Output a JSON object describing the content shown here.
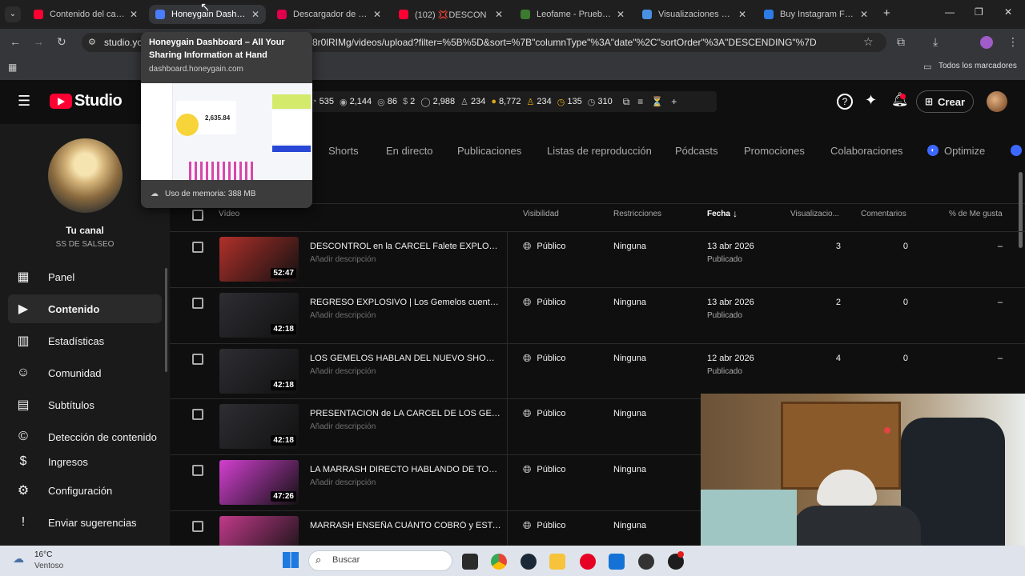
{
  "browser": {
    "tabs": [
      {
        "title": "Contenido del canal",
        "active": false,
        "color": "#ff0033"
      },
      {
        "title": "Honeygain Dashboard",
        "active": true,
        "color": "#4a7cff"
      },
      {
        "title": "Descargador de Vide",
        "active": false,
        "color": "#e0004d"
      },
      {
        "title": "(102) 💢DESCON",
        "active": false,
        "color": "#ff0033"
      },
      {
        "title": "Leofame - Prueba gr",
        "active": false,
        "color": "#3c7a2f"
      },
      {
        "title": "Visualizaciones Grat",
        "active": false,
        "color": "#4a90e2"
      },
      {
        "title": "Buy Instagram Follo",
        "active": false,
        "color": "#2d7be5"
      }
    ],
    "url_prefix": "studio.yo",
    "url_tail": "8r0lRIMg/videos/upload?filter=%5B%5D&sort=%7B\"columnType\"%3A\"date\"%2C\"sortOrder\"%3A\"DESCENDING\"%7D",
    "bookmarks_label": "Todos los marcadores"
  },
  "tooltip": {
    "title": "Honeygain Dashboard – All Your Sharing Information at Hand",
    "domain": "dashboard.honeygain.com",
    "preview_amount": "2,635.84",
    "memory": "Uso de memoria: 388 MB"
  },
  "studio": {
    "logo_text": "Studio",
    "stats": [
      "535",
      "2,144",
      "86",
      "2",
      "2,988",
      "234",
      "8,772",
      "234",
      "135",
      "310"
    ],
    "create_label": "Crear"
  },
  "channel": {
    "label": "Tu canal",
    "name": "SS DE SALSEO"
  },
  "nav": [
    {
      "label": "Panel",
      "icon": "dashboard-icon",
      "selected": false
    },
    {
      "label": "Contenido",
      "icon": "content-icon",
      "selected": true
    },
    {
      "label": "Estadísticas",
      "icon": "analytics-icon",
      "selected": false
    },
    {
      "label": "Comunidad",
      "icon": "community-icon",
      "selected": false
    },
    {
      "label": "Subtítulos",
      "icon": "subtitles-icon",
      "selected": false
    },
    {
      "label": "Detección de contenido",
      "icon": "copyright-icon",
      "selected": false
    },
    {
      "label": "Ingresos",
      "icon": "earn-icon",
      "selected": false
    }
  ],
  "nav_bottom": [
    {
      "label": "Configuración",
      "icon": "settings-icon"
    },
    {
      "label": "Enviar sugerencias",
      "icon": "feedback-icon"
    }
  ],
  "content_tabs": [
    "Shorts",
    "En directo",
    "Publicaciones",
    "Listas de reproducción",
    "Pódcasts",
    "Promociones",
    "Colaboraciones",
    "Optimize"
  ],
  "table": {
    "headers": {
      "video": "Vídeo",
      "visibility": "Visibilidad",
      "restrictions": "Restricciones",
      "date": "Fecha",
      "views": "Visualizacio...",
      "comments": "Comentarios",
      "likes": "% de Me gusta"
    },
    "rows": [
      {
        "title": "DESCONTROL en la CARCEL Falete EXPLOTA c...",
        "desc": "Añadir descripción",
        "duration": "52:47",
        "visibility": "Público",
        "restrictions": "Ninguna",
        "date": "13 abr 2026",
        "status": "Publicado",
        "views": "3",
        "comments": "0",
        "likes": "–",
        "thumb": "#b0302a"
      },
      {
        "title": "REGRESO EXPLOSIVO | Los Gemelos cuentan ...",
        "desc": "Añadir descripción",
        "duration": "42:18",
        "visibility": "Público",
        "restrictions": "Ninguna",
        "date": "13 abr 2026",
        "status": "Publicado",
        "views": "2",
        "comments": "0",
        "likes": "–",
        "thumb": "#2e2e33"
      },
      {
        "title": "LOS GEMELOS HABLAN DEL NUEVO SHOW LA...",
        "desc": "Añadir descripción",
        "duration": "42:18",
        "visibility": "Público",
        "restrictions": "Ninguna",
        "date": "12 abr 2026",
        "status": "Publicado",
        "views": "4",
        "comments": "0",
        "likes": "–",
        "thumb": "#2e2e33"
      },
      {
        "title": "PRESENTACION de LA CARCEL DE LOS GEME...",
        "desc": "Añadir descripción",
        "duration": "42:18",
        "visibility": "Público",
        "restrictions": "Ninguna",
        "date": "",
        "status": "",
        "views": "",
        "comments": "",
        "likes": "",
        "thumb": "#2e2e33"
      },
      {
        "title": "LA MARRASH DIRECTO HABLANDO DE TODO ...",
        "desc": "Añadir descripción",
        "duration": "47:26",
        "visibility": "Público",
        "restrictions": "Ninguna",
        "date": "",
        "status": "",
        "views": "",
        "comments": "",
        "likes": "",
        "thumb": "#d23fd0"
      },
      {
        "title": "MARRASH ENSEÑA CUÁNTO COBRÓ y ESTAL...",
        "desc": "",
        "duration": "",
        "visibility": "Público",
        "restrictions": "Ninguna",
        "date": "",
        "status": "",
        "views": "",
        "comments": "",
        "likes": "",
        "thumb": "#c03a8a"
      }
    ]
  },
  "taskbar": {
    "weather_temp": "16°C",
    "weather_desc": "Ventoso",
    "search_placeholder": "Buscar"
  }
}
